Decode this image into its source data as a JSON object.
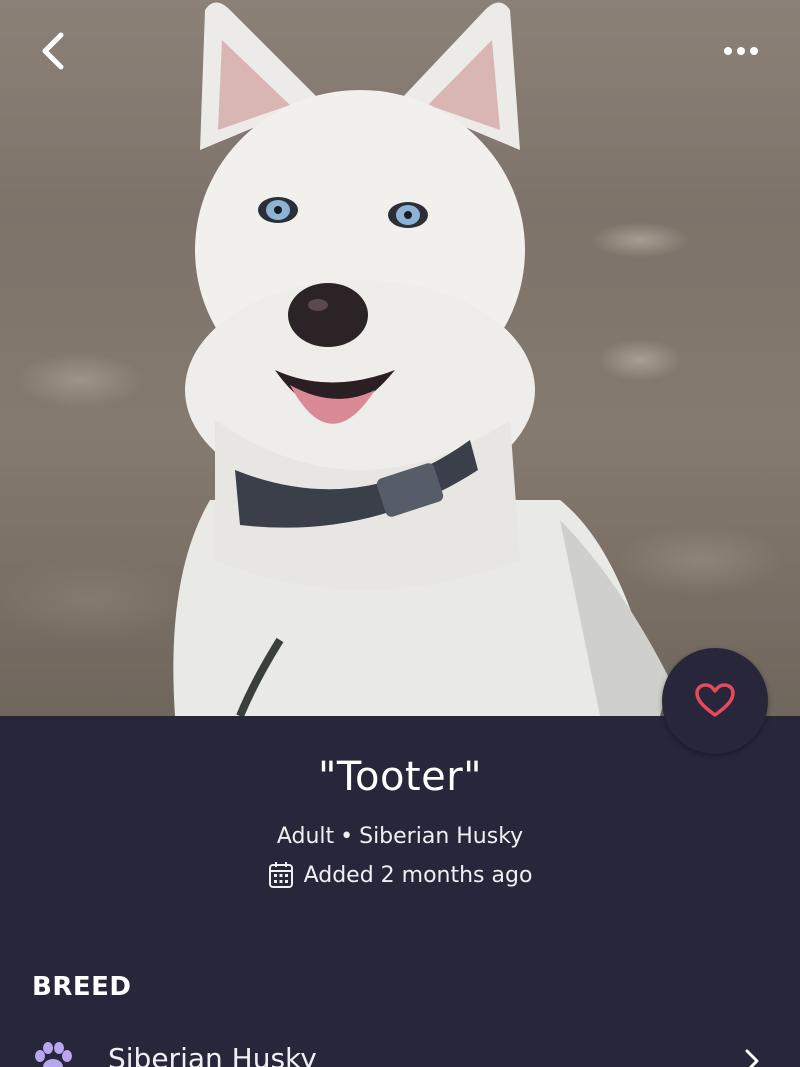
{
  "header": {
    "back_icon": "chevron-left-icon",
    "more_icon": "more-horizontal-icon"
  },
  "pet": {
    "name": "\"Tooter\"",
    "age": "Adult",
    "separator": "•",
    "breed": "Siberian Husky",
    "added": "Added 2 months ago",
    "photo_subject": "white siberian husky"
  },
  "favorite": {
    "icon": "heart-outline-icon",
    "color": "#e64a5a"
  },
  "breed_section": {
    "title": "BREED",
    "item_label": "Siberian Husky",
    "item_icon": "paw-icon",
    "item_icon_color": "#b9a6f0"
  },
  "colors": {
    "background": "#28263b",
    "text": "#ffffff"
  }
}
